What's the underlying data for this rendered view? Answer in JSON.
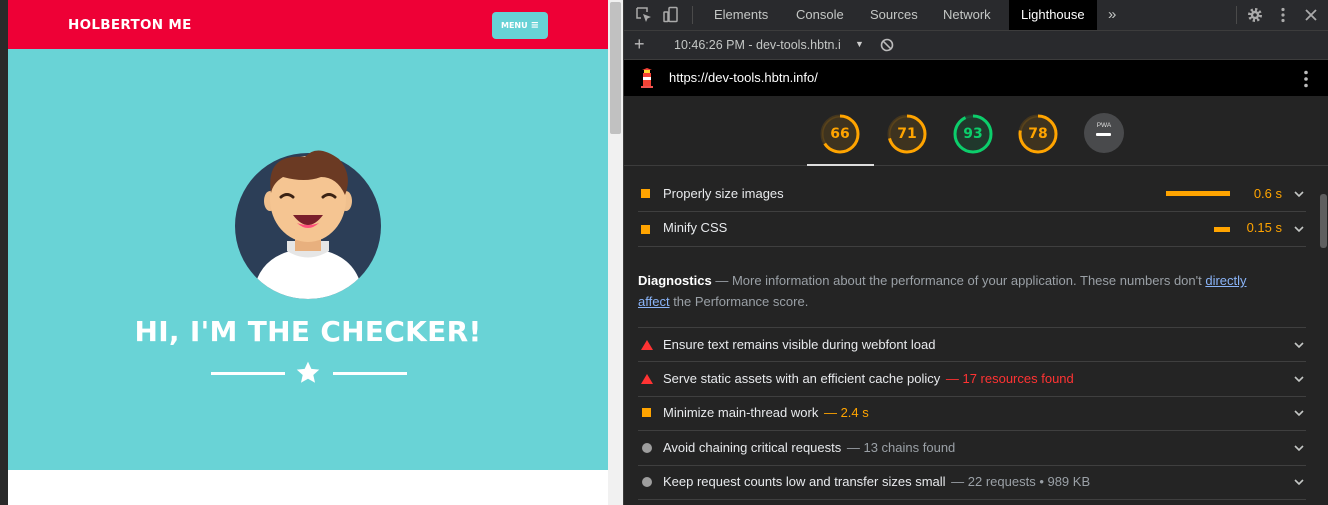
{
  "site": {
    "brand": "HOLBERTON ME",
    "menu_label": "MENU",
    "hero_title": "HI, I'M THE CHECKER!",
    "colors": {
      "header": "#ee0036",
      "hero": "#69d3d6",
      "menu_button": "#67d2d6"
    }
  },
  "devtools": {
    "tabs": [
      "Elements",
      "Console",
      "Sources",
      "Network",
      "Lighthouse"
    ],
    "active_tab": "Lighthouse",
    "report_selector": "10:46:26 PM - dev-tools.hbtn.i",
    "url": "https://dev-tools.hbtn.info/",
    "scores": [
      {
        "value": "66",
        "score": 0.66,
        "color": "#ffa400"
      },
      {
        "value": "71",
        "score": 0.71,
        "color": "#ffa400"
      },
      {
        "value": "93",
        "score": 0.93,
        "color": "#0cce6b"
      },
      {
        "value": "78",
        "score": 0.78,
        "color": "#ffa400"
      }
    ],
    "pwa_label": "PWA",
    "opportunities": [
      {
        "title": "Properly size images",
        "value": "0.6 s",
        "bar_fraction": 1.0
      },
      {
        "title": "Minify CSS",
        "value": "0.15 s",
        "bar_fraction": 0.25
      }
    ],
    "diagnostics": {
      "heading": "Diagnostics",
      "dash": "—",
      "text": "More information about the performance of your application. These numbers don't",
      "link": "directly affect",
      "link_part1": "directly",
      "link_part2": "affect",
      "tail": "the Performance score."
    },
    "audits": [
      {
        "title": "Ensure text remains visible during webfont load",
        "display": "",
        "status": "fail"
      },
      {
        "title": "Serve static assets with an efficient cache policy",
        "display": "— 17 resources found",
        "status": "fail"
      },
      {
        "title": "Minimize main-thread work",
        "display": "— 2.4 s",
        "status": "average"
      },
      {
        "title": "Avoid chaining critical requests",
        "display": "— 13 chains found",
        "status": "info"
      },
      {
        "title": "Keep request counts low and transfer sizes small",
        "display": "— 22 requests • 989 KB",
        "status": "info"
      }
    ]
  }
}
